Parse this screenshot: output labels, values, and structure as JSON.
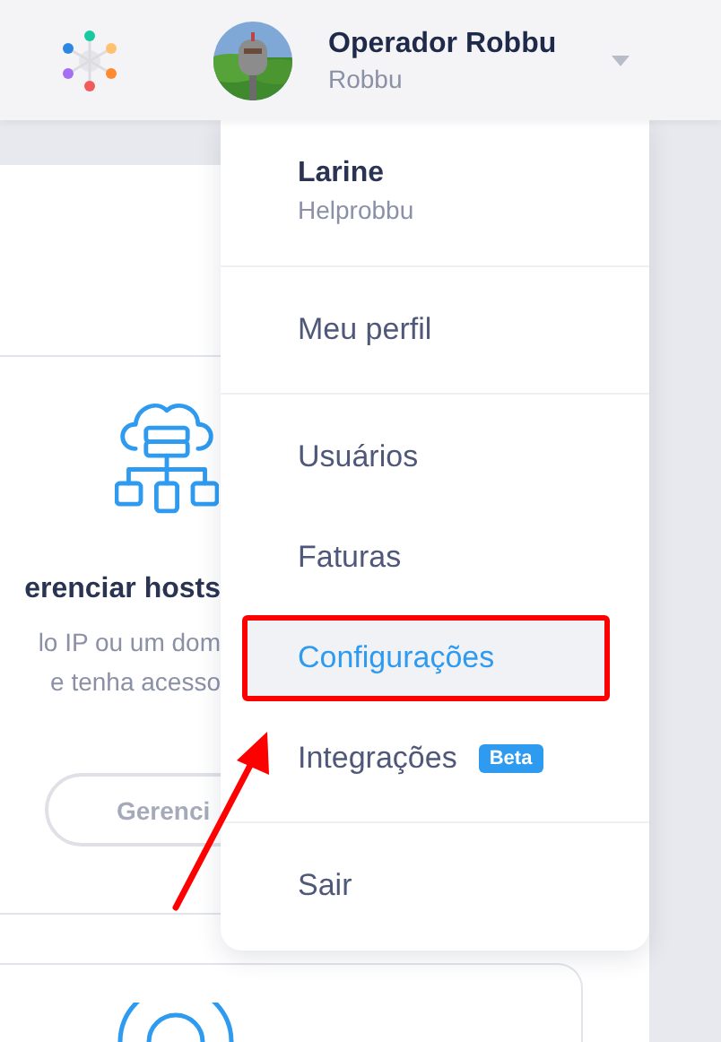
{
  "header": {
    "user": {
      "name": "Operador Robbu",
      "org": "Robbu"
    }
  },
  "background": {
    "card": {
      "title": "erenciar hosts",
      "description": [
        "lo IP ou um dom",
        "e tenha acesso"
      ],
      "button": "Gerenci"
    }
  },
  "menu": {
    "account": {
      "name": "Larine",
      "org": "Helprobbu"
    },
    "sections": [
      [
        {
          "label": "Meu perfil",
          "selected": false,
          "annotated": false
        }
      ],
      [
        {
          "label": "Usuários",
          "selected": false,
          "annotated": false
        },
        {
          "label": "Faturas",
          "selected": false,
          "annotated": false
        },
        {
          "label": "Configurações",
          "selected": true,
          "annotated": true
        },
        {
          "label": "Integrações",
          "selected": false,
          "annotated": false,
          "badge": "Beta"
        }
      ],
      [
        {
          "label": "Sair",
          "selected": false,
          "annotated": false
        }
      ]
    ]
  }
}
